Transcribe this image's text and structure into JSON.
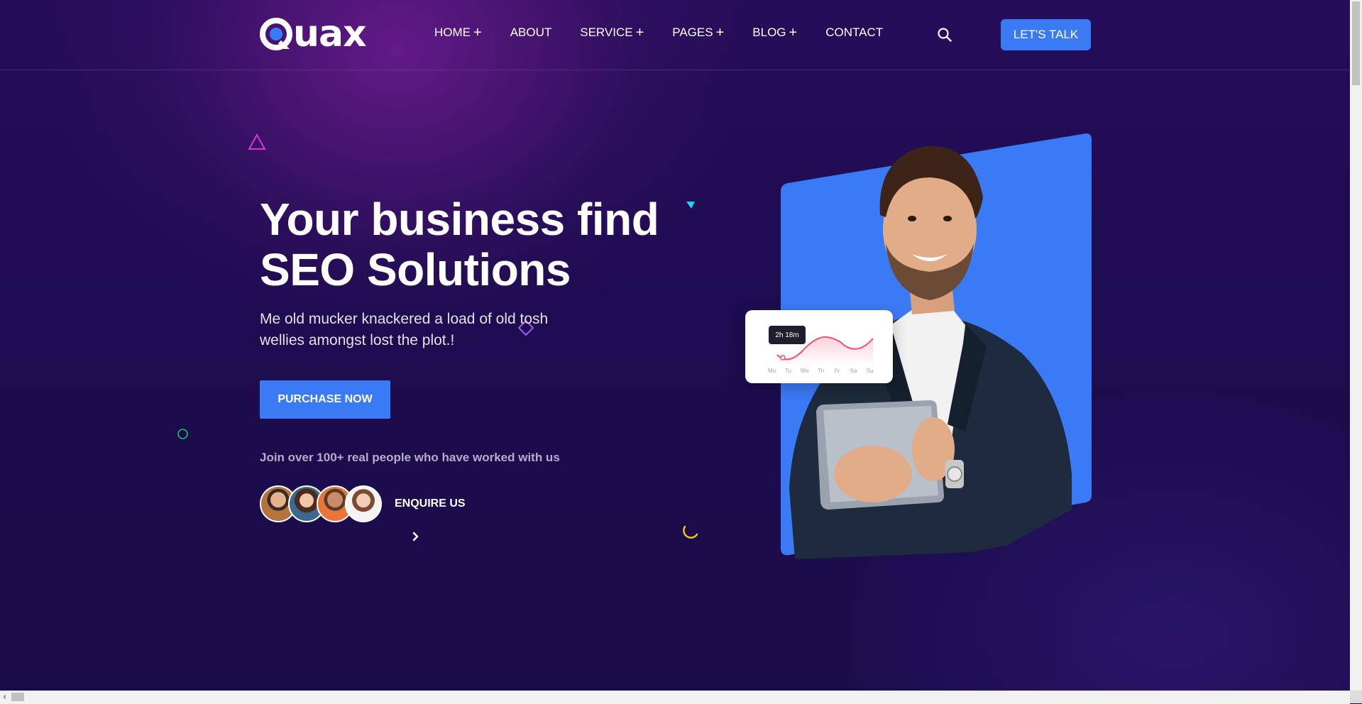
{
  "header": {
    "logo_text": "uax",
    "nav": [
      {
        "label": "HOME",
        "has_submenu": true
      },
      {
        "label": "ABOUT",
        "has_submenu": false
      },
      {
        "label": "SERVICE",
        "has_submenu": true
      },
      {
        "label": "PAGES",
        "has_submenu": true
      },
      {
        "label": "BLOG",
        "has_submenu": true
      },
      {
        "label": "CONTACT",
        "has_submenu": false
      }
    ],
    "submenu_symbol": "+",
    "search_icon": "search-icon",
    "cta_label": "LET'S TALK"
  },
  "hero": {
    "title_line1": "Your business find",
    "title_line2": "SEO Solutions",
    "subtitle": "Me old mucker knackered a load of old tosh wellies amongst lost the plot.!",
    "purchase_label": "PURCHASE NOW",
    "join_text": "Join over 100+ real people who have worked with us",
    "enquire_label": "ENQUIRE US",
    "stat_card": {
      "badge": "2h 18m",
      "days": [
        "Mo",
        "Tu",
        "We",
        "Th",
        "Fr",
        "Sa",
        "Su"
      ]
    }
  },
  "colors": {
    "accent": "#3b7af5",
    "background": "#1f0d52",
    "text": "#ffffff"
  }
}
